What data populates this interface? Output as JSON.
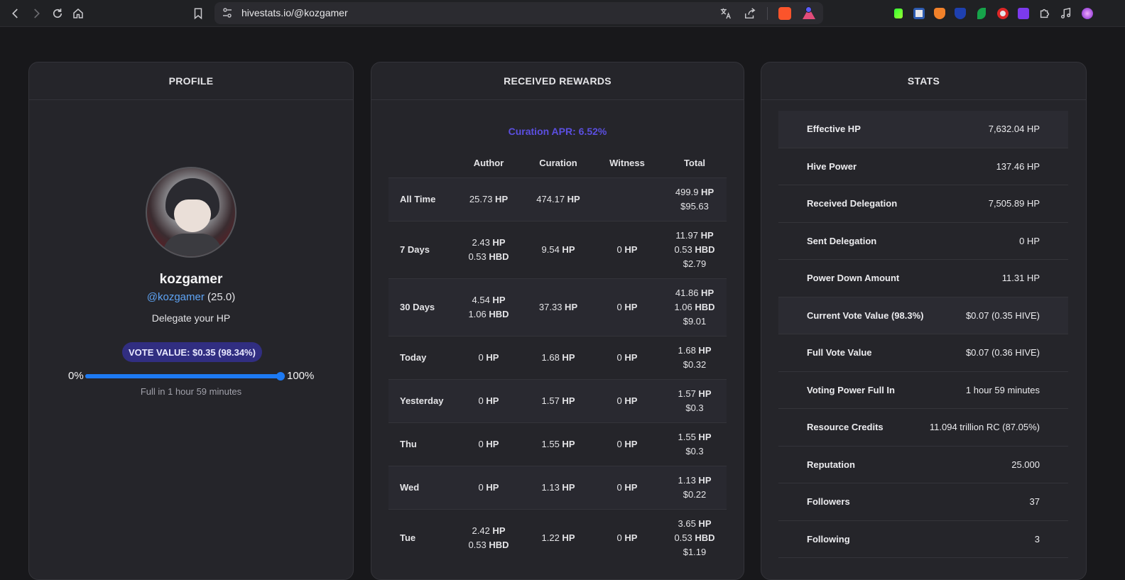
{
  "browser": {
    "url": "hivestats.io/@kozgamer"
  },
  "profile": {
    "header": "PROFILE",
    "name": "kozgamer",
    "handle": "@kozgamer",
    "reputation": "(25.0)",
    "delegate_text": "Delegate your HP",
    "vote_value_label": "VOTE VALUE: $0.35 (98.34%)",
    "voting_power_percent": 98.34,
    "min_label": "0%",
    "max_label": "100%",
    "full_in": "Full in 1 hour 59 minutes"
  },
  "rewards": {
    "header": "RECEIVED REWARDS",
    "curation_apr": "Curation APR: 6.52%",
    "columns": [
      "",
      "Author",
      "Curation",
      "Witness",
      "Total"
    ],
    "rows": [
      {
        "label": "All Time",
        "author": [
          [
            "25.73",
            "HP"
          ]
        ],
        "curation": [
          [
            "474.17",
            "HP"
          ]
        ],
        "witness": [],
        "total": [
          [
            "499.9",
            "HP"
          ],
          [
            "$95.63",
            ""
          ]
        ]
      },
      {
        "label": "7 Days",
        "author": [
          [
            "2.43",
            "HP"
          ],
          [
            "0.53",
            "HBD"
          ]
        ],
        "curation": [
          [
            "9.54",
            "HP"
          ]
        ],
        "witness": [
          [
            "0",
            "HP"
          ]
        ],
        "total": [
          [
            "11.97",
            "HP"
          ],
          [
            "0.53",
            "HBD"
          ],
          [
            "$2.79",
            ""
          ]
        ]
      },
      {
        "label": "30 Days",
        "author": [
          [
            "4.54",
            "HP"
          ],
          [
            "1.06",
            "HBD"
          ]
        ],
        "curation": [
          [
            "37.33",
            "HP"
          ]
        ],
        "witness": [
          [
            "0",
            "HP"
          ]
        ],
        "total": [
          [
            "41.86",
            "HP"
          ],
          [
            "1.06",
            "HBD"
          ],
          [
            "$9.01",
            ""
          ]
        ]
      },
      {
        "label": "Today",
        "author": [
          [
            "0",
            "HP"
          ]
        ],
        "curation": [
          [
            "1.68",
            "HP"
          ]
        ],
        "witness": [
          [
            "0",
            "HP"
          ]
        ],
        "total": [
          [
            "1.68",
            "HP"
          ],
          [
            "$0.32",
            ""
          ]
        ]
      },
      {
        "label": "Yesterday",
        "author": [
          [
            "0",
            "HP"
          ]
        ],
        "curation": [
          [
            "1.57",
            "HP"
          ]
        ],
        "witness": [
          [
            "0",
            "HP"
          ]
        ],
        "total": [
          [
            "1.57",
            "HP"
          ],
          [
            "$0.3",
            ""
          ]
        ]
      },
      {
        "label": "Thu",
        "author": [
          [
            "0",
            "HP"
          ]
        ],
        "curation": [
          [
            "1.55",
            "HP"
          ]
        ],
        "witness": [
          [
            "0",
            "HP"
          ]
        ],
        "total": [
          [
            "1.55",
            "HP"
          ],
          [
            "$0.3",
            ""
          ]
        ]
      },
      {
        "label": "Wed",
        "author": [
          [
            "0",
            "HP"
          ]
        ],
        "curation": [
          [
            "1.13",
            "HP"
          ]
        ],
        "witness": [
          [
            "0",
            "HP"
          ]
        ],
        "total": [
          [
            "1.13",
            "HP"
          ],
          [
            "$0.22",
            ""
          ]
        ]
      },
      {
        "label": "Tue",
        "author": [
          [
            "2.42",
            "HP"
          ],
          [
            "0.53",
            "HBD"
          ]
        ],
        "curation": [
          [
            "1.22",
            "HP"
          ]
        ],
        "witness": [
          [
            "0",
            "HP"
          ]
        ],
        "total": [
          [
            "3.65",
            "HP"
          ],
          [
            "0.53",
            "HBD"
          ],
          [
            "$1.19",
            ""
          ]
        ]
      }
    ]
  },
  "stats": {
    "header": "STATS",
    "rows": [
      {
        "key": "Effective HP",
        "value": "7,632.04 HP",
        "shaded": true
      },
      {
        "key": "Hive Power",
        "value": "137.46 HP",
        "shaded": false
      },
      {
        "key": "Received Delegation",
        "value": "7,505.89 HP",
        "shaded": false
      },
      {
        "key": "Sent Delegation",
        "value": "0 HP",
        "shaded": false
      },
      {
        "key": "Power Down Amount",
        "value": "11.31 HP",
        "shaded": false
      },
      {
        "key": "Current Vote Value (98.3%)",
        "value": "$0.07 (0.35 HIVE)",
        "shaded": true
      },
      {
        "key": "Full Vote Value",
        "value": "$0.07 (0.36 HIVE)",
        "shaded": false
      },
      {
        "key": "Voting Power Full In",
        "value": "1 hour 59 minutes",
        "shaded": false
      },
      {
        "key": "Resource Credits",
        "value": "11.094 trillion RC (87.05%)",
        "shaded": false
      },
      {
        "key": "Reputation",
        "value": "25.000",
        "shaded": false
      },
      {
        "key": "Followers",
        "value": "37",
        "shaded": false
      },
      {
        "key": "Following",
        "value": "3",
        "shaded": false
      }
    ]
  },
  "colors": {
    "page_bg": "#18181b",
    "card_bg": "#25252a",
    "accent_link": "#5ea4f5",
    "apr": "#5b4fe0",
    "vote_pill": "#312e81",
    "slider": "#1d7af3"
  }
}
